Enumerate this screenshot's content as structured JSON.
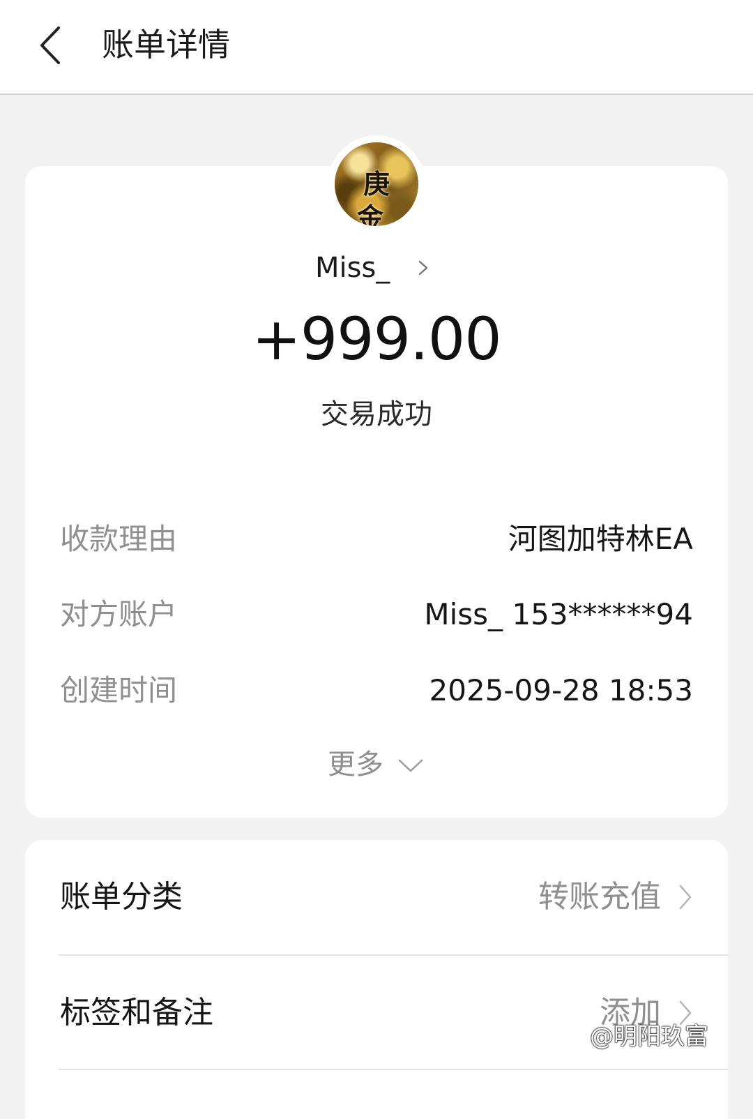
{
  "header": {
    "title": "账单详情",
    "back_icon": "chevron-left-icon"
  },
  "payer": {
    "avatar_text": "庚金",
    "name": "Miss_"
  },
  "transaction": {
    "amount": "+999.00",
    "status": "交易成功"
  },
  "details": [
    {
      "label": "收款理由",
      "value": "河图加特林EA"
    },
    {
      "label": "对方账户",
      "value": "Miss_ 153******94"
    },
    {
      "label": "创建时间",
      "value": "2025-09-28 18:53"
    }
  ],
  "more": {
    "label": "更多"
  },
  "settings": [
    {
      "label": "账单分类",
      "value": "转账充值"
    },
    {
      "label": "标签和备注",
      "value": "添加"
    }
  ],
  "watermark": "@明阳玖富",
  "colors": {
    "background": "#f2f2f2",
    "card": "#ffffff",
    "muted_text": "#8f8f8f",
    "primary_text": "#111111"
  }
}
